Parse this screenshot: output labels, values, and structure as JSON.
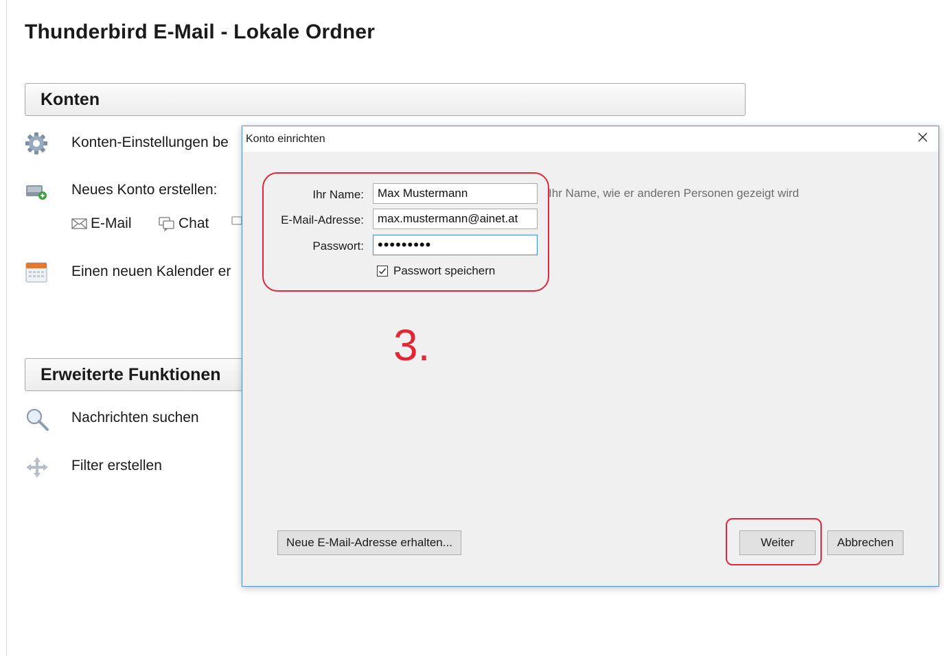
{
  "page": {
    "title": "Thunderbird E-Mail - Lokale Ordner"
  },
  "accounts_section": {
    "header": "Konten",
    "settings_label": "Konten-Einstellungen be",
    "new_account_label": "Neues Konto erstellen:",
    "new_links": [
      {
        "label": "E-Mail",
        "icon": "envelope-icon"
      },
      {
        "label": "Chat",
        "icon": "chat-icon"
      }
    ],
    "calendar_label": "Einen neuen Kalender er"
  },
  "advanced_section": {
    "header": "Erweiterte Funktionen",
    "search_label": "Nachrichten suchen",
    "filter_label": "Filter erstellen"
  },
  "dialog": {
    "title": "Konto einrichten",
    "name_label": "Ihr Name:",
    "name_value": "Max Mustermann",
    "name_hint": "Ihr Name, wie er anderen Personen gezeigt wird",
    "email_label": "E-Mail-Adresse:",
    "email_value": "max.mustermann@ainet.at",
    "password_label": "Passwort:",
    "password_value": "•••••••••",
    "remember_label": "Passwort speichern",
    "remember_checked": true,
    "new_address_button": "Neue E-Mail-Adresse erhalten...",
    "next_button": "Weiter",
    "cancel_button": "Abbrechen"
  },
  "annotation": {
    "step": "3."
  },
  "colors": {
    "annotation_red": "#e32636",
    "dialog_border": "#4a90d9",
    "focus_border": "#3c8ce0"
  }
}
